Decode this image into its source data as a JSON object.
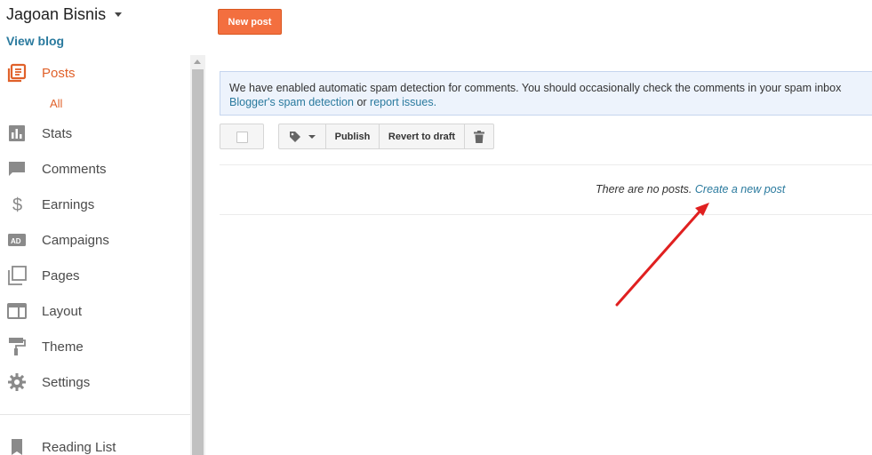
{
  "header": {
    "blog_title": "Jagoan Bisnis",
    "view_blog": "View blog",
    "new_post": "New post"
  },
  "sidebar": {
    "items": [
      {
        "label": "Posts",
        "icon": "posts-icon",
        "active": true
      },
      {
        "label": "Stats",
        "icon": "stats-icon"
      },
      {
        "label": "Comments",
        "icon": "comments-icon"
      },
      {
        "label": "Earnings",
        "icon": "dollar-icon"
      },
      {
        "label": "Campaigns",
        "icon": "ad-icon"
      },
      {
        "label": "Pages",
        "icon": "pages-icon"
      },
      {
        "label": "Layout",
        "icon": "layout-icon"
      },
      {
        "label": "Theme",
        "icon": "paint-roller-icon"
      },
      {
        "label": "Settings",
        "icon": "gear-icon"
      }
    ],
    "posts_sub": "All",
    "reading_list": "Reading List"
  },
  "notice": {
    "text": "We have enabled automatic spam detection for comments. You should occasionally check the comments in your spam inbox",
    "link1": "Blogger's spam detection",
    "or": " or ",
    "link2": "report issues."
  },
  "toolbar": {
    "publish": "Publish",
    "revert": "Revert to draft"
  },
  "empty_state": {
    "text": "There are no posts. ",
    "link": "Create a new post"
  },
  "colors": {
    "accent": "#f36f3f",
    "link": "#2a7a9e",
    "arrow": "#e02020"
  }
}
